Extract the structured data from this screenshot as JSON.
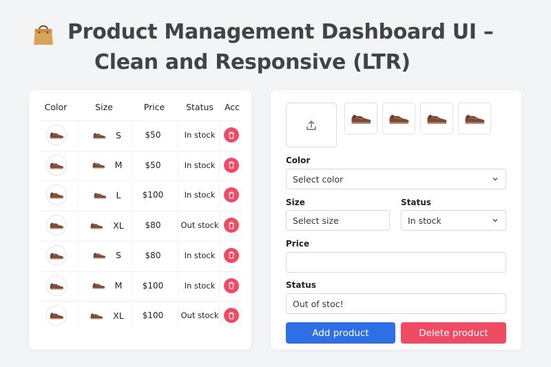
{
  "header": {
    "icon": "shopping-bag-icon",
    "title_line1": "Product Management Dashboard UI –",
    "title_line2": "Clean and Responsive (LTR)"
  },
  "table": {
    "columns": [
      "Color",
      "Size",
      "Price",
      "Status",
      "Acc"
    ],
    "rows": [
      {
        "size": "S",
        "price": "$50",
        "status": "In stock"
      },
      {
        "size": "M",
        "price": "$50",
        "status": "In stock"
      },
      {
        "size": "L",
        "price": "$100",
        "status": "In stock"
      },
      {
        "size": "XL",
        "price": "$80",
        "status": "Out stock"
      },
      {
        "size": "S",
        "price": "$80",
        "status": "In stock"
      },
      {
        "size": "M",
        "price": "$100",
        "status": "In stock"
      },
      {
        "size": "XL",
        "price": "$100",
        "status": "Out stock"
      }
    ]
  },
  "form": {
    "upload_icon": "upload-icon",
    "thumbnail_icon": "shoe-icon",
    "color_label": "Color",
    "color_value": "Select color",
    "size_label": "Size",
    "size_value": "Select size",
    "status_label": "Status",
    "status_value": "In stock",
    "price_label": "Price",
    "price_value": "",
    "status2_label": "Status",
    "status2_value": "Out of stoc!",
    "add_button": "Add product",
    "delete_button": "Delete product"
  },
  "colors": {
    "add_button": "#2f6fe6",
    "delete_button": "#ef4b63",
    "trash_button": "#ef4b66",
    "title_text": "#3f4446"
  }
}
